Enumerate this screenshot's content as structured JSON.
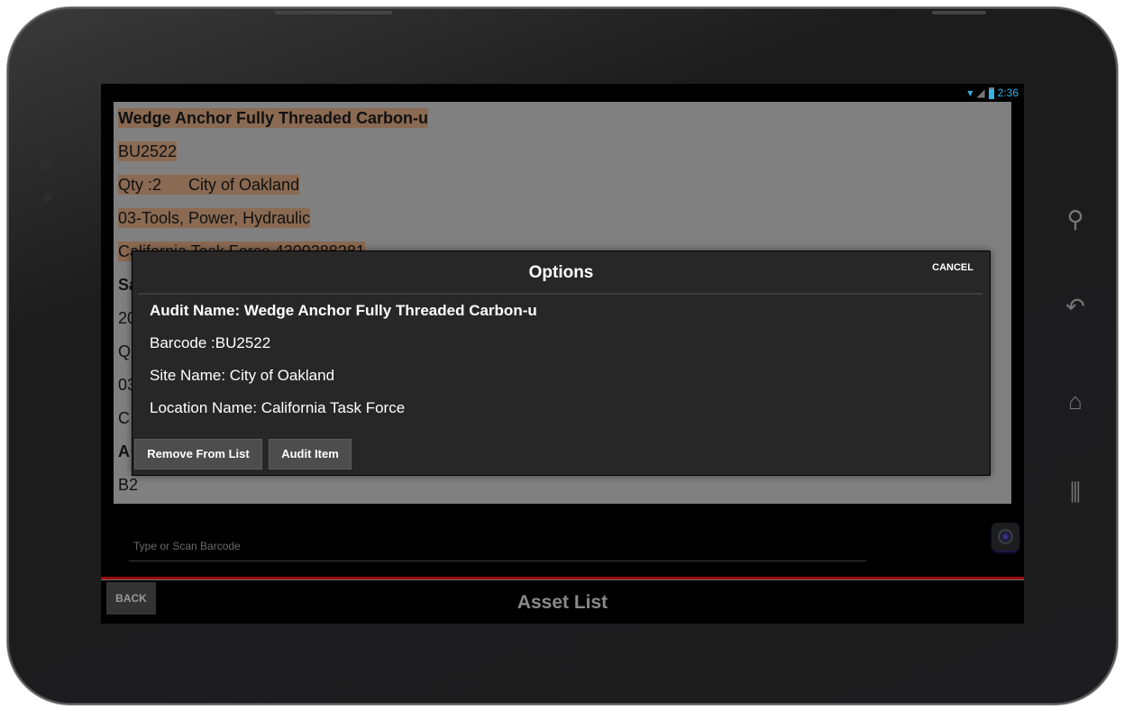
{
  "status_bar": {
    "time": "2:36",
    "icons": [
      "wifi-icon",
      "signal-icon",
      "battery-icon"
    ],
    "accent": "#33b5e5"
  },
  "asset_list": {
    "rows": [
      "Wedge Anchor Fully Threaded Carbon-u",
      "BU2522",
      "Qty :2      City of Oakland",
      "03-Tools, Power, Hydraulic",
      "California Task Force 4300288281",
      "Sa",
      "20",
      "Q",
      "03",
      "C",
      "A",
      "B2"
    ],
    "highlight_color": "#8a6a52"
  },
  "dialog": {
    "title": "Options",
    "cancel_label": "CANCEL",
    "audit_name": "Audit Name: Wedge Anchor Fully Threaded Carbon-u",
    "barcode": "Barcode :BU2522",
    "site_name": "Site Name: City of Oakland",
    "location_name": "Location Name: California Task Force",
    "remove_label": "Remove From List",
    "audit_label": "Audit Item"
  },
  "barcode_input": {
    "placeholder": "Type or Scan Barcode",
    "value": ""
  },
  "footer": {
    "back_label": "BACK",
    "title": "Asset List",
    "accent": "#9b0a0a"
  }
}
